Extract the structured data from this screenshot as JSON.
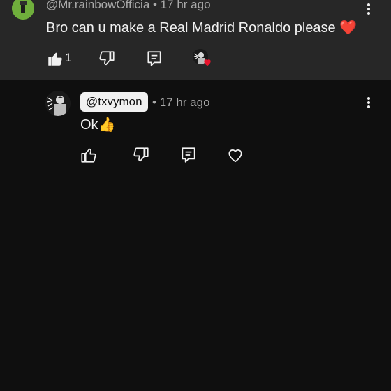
{
  "top_comment": {
    "author": "@Mr.rainbowOfficia",
    "time": "17 hr ago",
    "text": "Bro can u make a Real Madrid Ronaldo please",
    "text_emoji": "❤️",
    "like_count": "1",
    "creator_heart": true
  },
  "reply": {
    "mention": "@txvymon",
    "time": "17 hr ago",
    "text": "Ok",
    "text_emoji": "👍"
  },
  "separator": "•",
  "icons": [
    "like-icon",
    "dislike-icon",
    "reply-icon",
    "heart-icon",
    "more-options-icon"
  ],
  "colors": {
    "top_background": "#272727",
    "background": "#0f0f0f",
    "text": "#f1f1f1",
    "meta": "#aaaaaa",
    "heart": "#e8132c",
    "avatar_green": "#6fae3c"
  }
}
